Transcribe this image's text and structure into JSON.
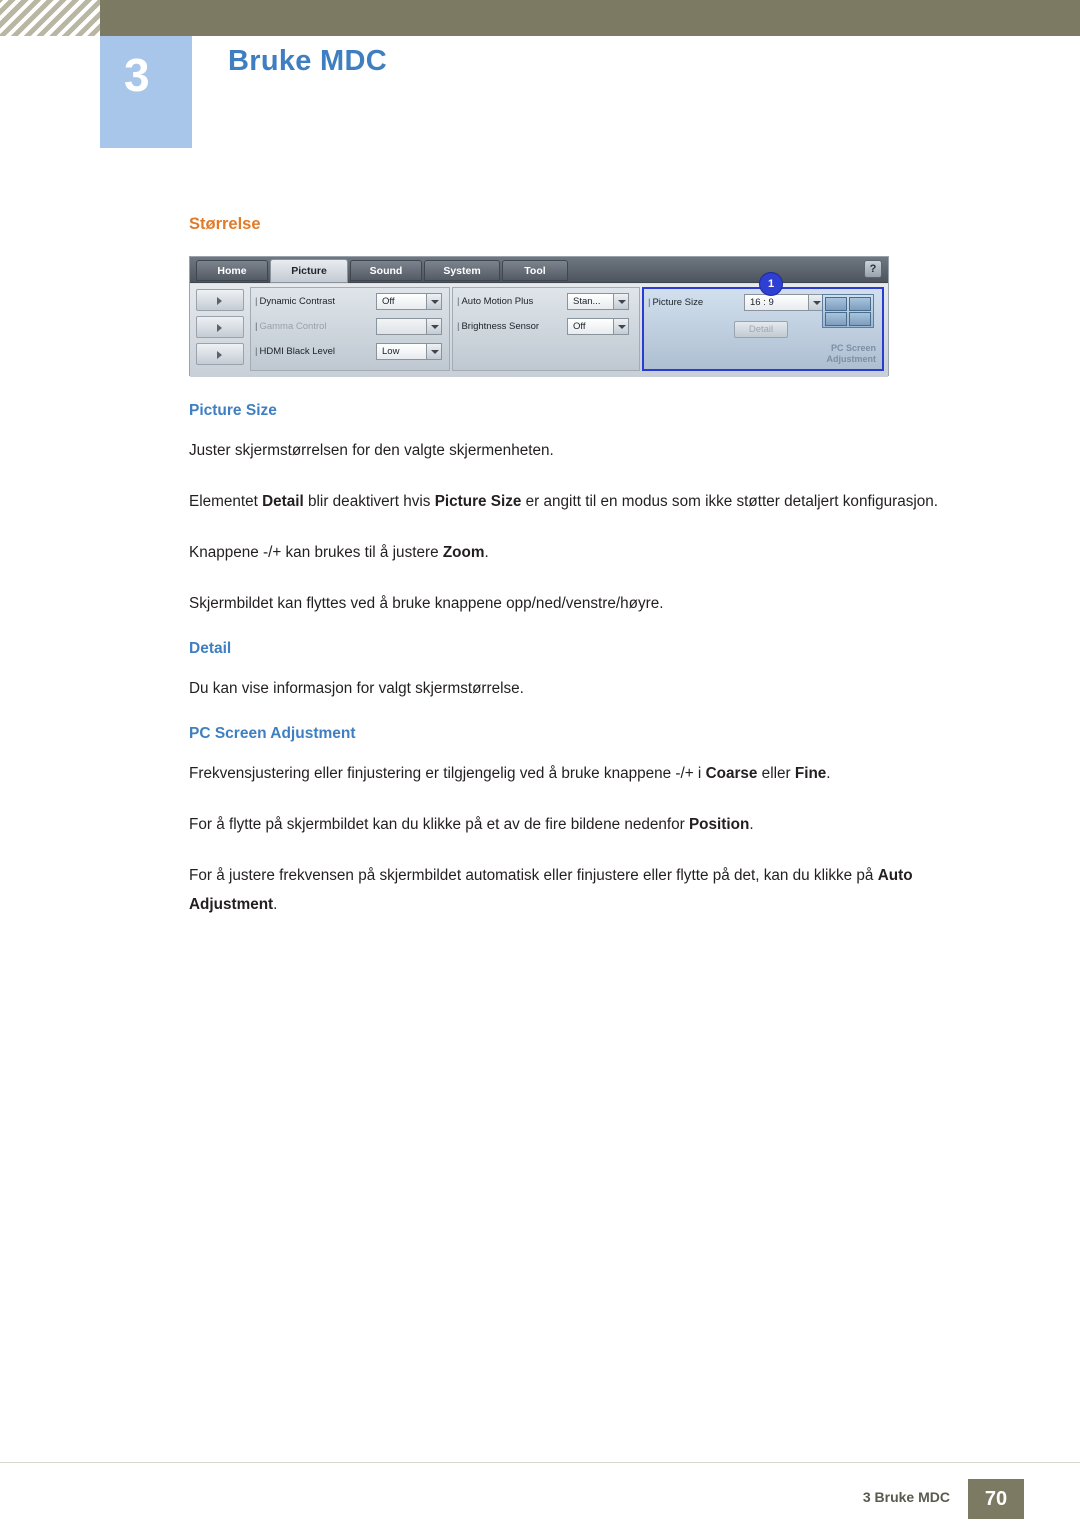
{
  "header": {
    "chapter_number": "3",
    "chapter_title": "Bruke MDC"
  },
  "section": {
    "title": "Størrelse"
  },
  "mdc_ui": {
    "tabs": [
      {
        "label": "Home",
        "active": false
      },
      {
        "label": "Picture",
        "active": true
      },
      {
        "label": "Sound",
        "active": false
      },
      {
        "label": "System",
        "active": false
      },
      {
        "label": "Tool",
        "active": false
      }
    ],
    "help_label": "?",
    "callout_number": "1",
    "group1": [
      {
        "label": "Dynamic Contrast",
        "value": "Off",
        "disabled": false
      },
      {
        "label": "Gamma Control",
        "value": "",
        "disabled": true
      },
      {
        "label": "HDMI Black Level",
        "value": "Low",
        "disabled": false
      }
    ],
    "group2": [
      {
        "label": "Auto Motion Plus",
        "value": "Stan...",
        "disabled": false
      },
      {
        "label": "Brightness Sensor",
        "value": "Off",
        "disabled": false
      }
    ],
    "group3": {
      "label": "Picture Size",
      "value": "16 : 9",
      "detail_button": "Detail",
      "screen_adjust_line1": "PC Screen",
      "screen_adjust_line2": "Adjustment"
    }
  },
  "body": {
    "picture_size_heading": "Picture Size",
    "p1": "Juster skjermstørrelsen for den valgte skjermenheten.",
    "p2_a": "Elementet ",
    "p2_b": "Detail",
    "p2_c": " blir deaktivert hvis ",
    "p2_d": "Picture Size",
    "p2_e": " er angitt til en modus som ikke støtter detaljert konfigurasjon.",
    "p3_a": "Knappene -/+ kan brukes til å justere ",
    "p3_b": "Zoom",
    "p3_c": ".",
    "p4": "Skjermbildet kan flyttes ved å bruke knappene opp/ned/venstre/høyre.",
    "detail_heading": "Detail",
    "p5": "Du kan vise informasjon for valgt skjermstørrelse.",
    "pc_screen_heading": "PC Screen Adjustment",
    "p6_a": "Frekvensjustering eller finjustering er tilgjengelig ved å bruke knappene -/+ i ",
    "p6_b": "Coarse",
    "p6_c": " eller ",
    "p6_d": "Fine",
    "p6_e": ".",
    "p7_a": "For å flytte på skjermbildet kan du klikke på et av de fire bildene nedenfor ",
    "p7_b": "Position",
    "p7_c": ".",
    "p8_a": "For å justere frekvensen på skjermbildet automatisk eller finjustere eller flytte på det, kan du klikke på ",
    "p8_b": "Auto Adjustment",
    "p8_c": "."
  },
  "footer": {
    "text": "3 Bruke MDC",
    "page": "70"
  }
}
